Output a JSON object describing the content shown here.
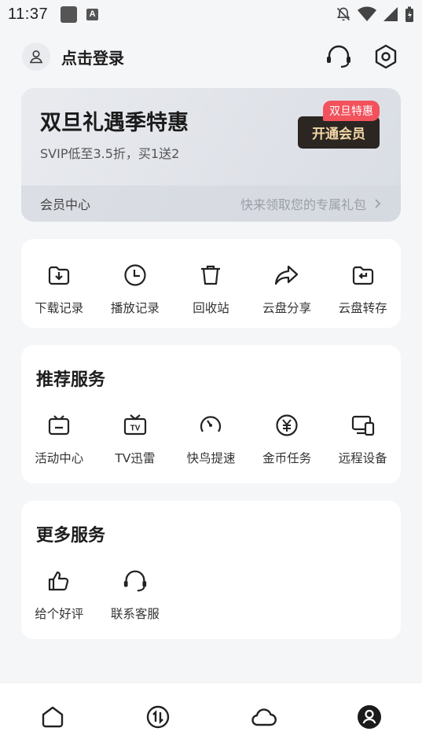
{
  "status_bar": {
    "time": "11:37",
    "icons": [
      "gallery-icon",
      "a-icon",
      "bell-off-icon",
      "wifi-icon",
      "signal-icon",
      "battery-icon"
    ]
  },
  "header": {
    "login_label": "点击登录",
    "icons": [
      "avatar-icon",
      "customer-service-icon",
      "settings-icon"
    ]
  },
  "vip_card": {
    "title": "双旦礼遇季特惠",
    "subtitle": "SVIP低至3.5折，买1送2",
    "tag": "双旦特惠",
    "button_label": "开通会员",
    "center_label": "会员中心",
    "promo_text": "快来领取您的专属礼包"
  },
  "quick_actions": [
    {
      "label": "下载记录",
      "icon": "download-record-icon"
    },
    {
      "label": "播放记录",
      "icon": "clock-icon"
    },
    {
      "label": "回收站",
      "icon": "trash-icon"
    },
    {
      "label": "云盘分享",
      "icon": "share-icon"
    },
    {
      "label": "云盘转存",
      "icon": "folder-transfer-icon"
    }
  ],
  "recommended": {
    "title": "推荐服务",
    "items": [
      {
        "label": "活动中心",
        "icon": "activity-icon"
      },
      {
        "label": "TV迅雷",
        "icon": "tv-icon"
      },
      {
        "label": "快鸟提速",
        "icon": "speed-gauge-icon"
      },
      {
        "label": "金币任务",
        "icon": "coin-icon"
      },
      {
        "label": "远程设备",
        "icon": "remote-device-icon"
      }
    ]
  },
  "more": {
    "title": "更多服务",
    "items": [
      {
        "label": "给个好评",
        "icon": "thumb-up-icon"
      },
      {
        "label": "联系客服",
        "icon": "customer-service-icon"
      }
    ]
  },
  "bottom_nav": [
    {
      "name": "home",
      "icon": "home-icon",
      "active": false
    },
    {
      "name": "transfer",
      "icon": "transfer-icon",
      "active": false
    },
    {
      "name": "cloud",
      "icon": "cloud-icon",
      "active": false
    },
    {
      "name": "me",
      "icon": "profile-icon",
      "active": true
    }
  ],
  "colors": {
    "background": "#f5f6f8",
    "vip_button_bg": "#2b2622",
    "vip_button_text": "#f3d7a6",
    "tag_red": "#f2525c"
  }
}
